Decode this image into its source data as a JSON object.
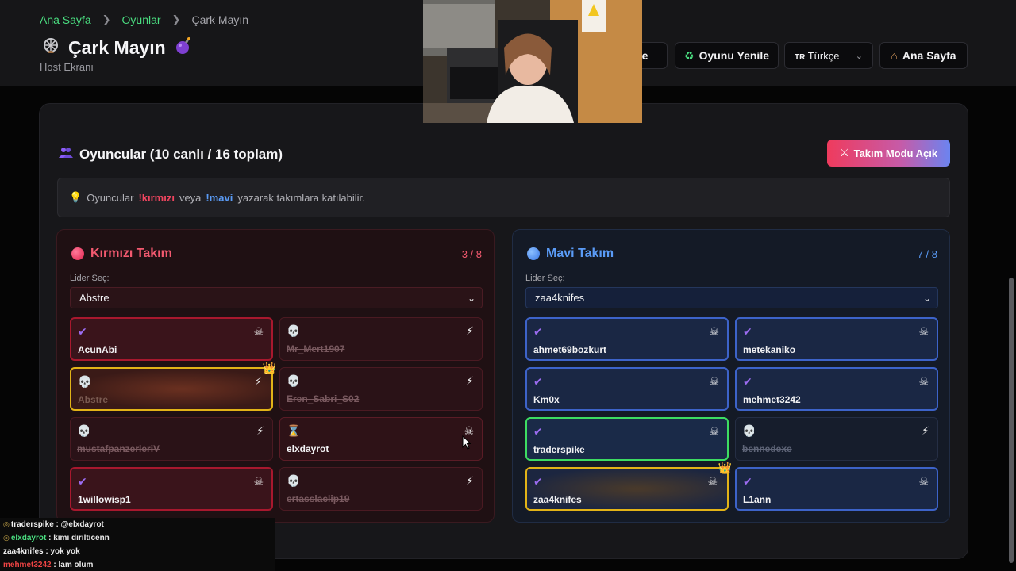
{
  "breadcrumb": {
    "home": "Ana Sayfa",
    "games": "Oyunlar",
    "current": "Çark Mayın"
  },
  "page": {
    "title": "Çark Mayın",
    "subtitle": "Host Ekranı",
    "title_icon": "wheel-icon",
    "title_icon_right": "bomb-icon"
  },
  "header_buttons": {
    "partial": "enile",
    "restart": "Oyunu Yenile",
    "language_flag": "TR",
    "language": "Türkçe",
    "home": "Ana Sayfa"
  },
  "players": {
    "title": "Oyuncular (10 canlı / 16 toplam)",
    "team_mode": "Takım Modu Açık"
  },
  "info": {
    "prefix": "Oyuncular",
    "red_cmd": "!kırmızı",
    "or": "veya",
    "blue_cmd": "!mavi",
    "suffix": "yazarak takımlara katılabilir."
  },
  "red_team": {
    "name": "Kırmızı Takım",
    "count": "3 / 8",
    "leader_label": "Lider Seç:",
    "leader": "Abstre",
    "players": [
      {
        "name": "AcunAbi",
        "status": "alive"
      },
      {
        "name": "Mr_Mert1907",
        "status": "dead"
      },
      {
        "name": "Abstre",
        "status": "dead",
        "leader": true
      },
      {
        "name": "Eren_Sabri_S02",
        "status": "dead"
      },
      {
        "name": "mustafpanzerleriV",
        "status": "dead"
      },
      {
        "name": "elxdayrot",
        "status": "waiting"
      },
      {
        "name": "1willowisp1",
        "status": "alive"
      },
      {
        "name": "ertasslaclip19",
        "status": "dead"
      }
    ]
  },
  "blue_team": {
    "name": "Mavi Takım",
    "count": "7 / 8",
    "leader_label": "Lider Seç:",
    "leader": "zaa4knifes",
    "players": [
      {
        "name": "ahmet69bozkurt",
        "status": "alive"
      },
      {
        "name": "metekaniko",
        "status": "alive"
      },
      {
        "name": "Km0x",
        "status": "alive"
      },
      {
        "name": "mehmet3242",
        "status": "alive"
      },
      {
        "name": "traderspike",
        "status": "alive",
        "highlight": "green"
      },
      {
        "name": "bennedexe",
        "status": "dead"
      },
      {
        "name": "zaa4knifes",
        "status": "alive",
        "leader": true
      },
      {
        "name": "L1ann",
        "status": "alive"
      }
    ]
  },
  "chat": [
    {
      "user": "traderspike",
      "message": "@elxdayrot",
      "color": "#f2f2f2"
    },
    {
      "user": "elxdayrot",
      "message": "kımı dırıltıcenn",
      "color": "#4ade80"
    },
    {
      "user": "zaa4knifes",
      "message": "yok yok",
      "color": "#f2f2f2"
    },
    {
      "user": "mehmet3242",
      "message": "lam olum",
      "color": "#ef4444"
    }
  ],
  "colors": {
    "accent_green": "#4ade80",
    "red": "#f2596f",
    "blue": "#5a9bf6",
    "leader_gold": "#e2b317"
  }
}
